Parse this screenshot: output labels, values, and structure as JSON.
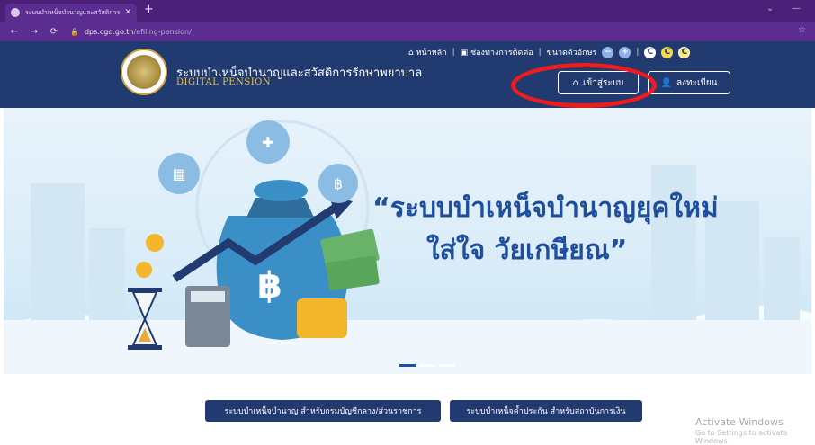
{
  "browser": {
    "tab_title": "ระบบบำเหน็จบำนาญและสวัสดิการรักษ",
    "new_tab": "+",
    "url_domain": "dps.cgd.go.th",
    "url_path": "/efiling-pension/"
  },
  "header": {
    "top_menu": {
      "home": "หน้าหลัก",
      "contact": "ช่องทางการติดต่อ",
      "font_size": "ขนาดตัวอักษร",
      "minus": "−",
      "plus": "+",
      "contrast": [
        "C",
        "C",
        "C"
      ]
    },
    "brand_th": "ระบบบำเหน็จบำนาญและสวัสดิการรักษาพยาบาล",
    "brand_en": "DIGITAL PENSION",
    "login_label": "เข้าสู่ระบบ",
    "register_label": "ลงทะเบียน"
  },
  "banner": {
    "line1": "“ระบบบำเหน็จบำนาญยุคใหม่",
    "line2": "ใส่ใจ วัยเกษียณ”",
    "currency_symbol": "฿"
  },
  "bottom": {
    "pension_button": "ระบบบำเหน็จบำนาญ สำหรับกรมบัญชีกลาง/ส่วนราชการ",
    "fund_button": "ระบบบำเหน็จค้ำประกัน สำหรับสถาบันการเงิน"
  },
  "watermark": {
    "line1": "Activate Windows",
    "line2": "Go to Settings to activate Windows"
  },
  "colors": {
    "header_bg": "#213a70",
    "browser_bg": "#5b2d90",
    "accent_red": "#ee1c1c",
    "headline": "#1f4e9c"
  }
}
